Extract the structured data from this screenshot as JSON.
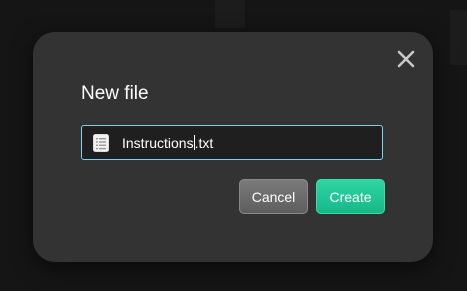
{
  "dialog": {
    "title": "New file",
    "close_icon": "close-icon",
    "filename": {
      "icon": "text-file-icon",
      "before_caret": "Instructions",
      "after_caret": ".txt"
    },
    "buttons": {
      "cancel": "Cancel",
      "create": "Create"
    }
  },
  "colors": {
    "backdrop": "#151515",
    "dialog_bg": "#333333",
    "field_border": "#7fd0e8",
    "create_accent": "#1fc693",
    "cancel_bg": "#6b6b6b"
  }
}
